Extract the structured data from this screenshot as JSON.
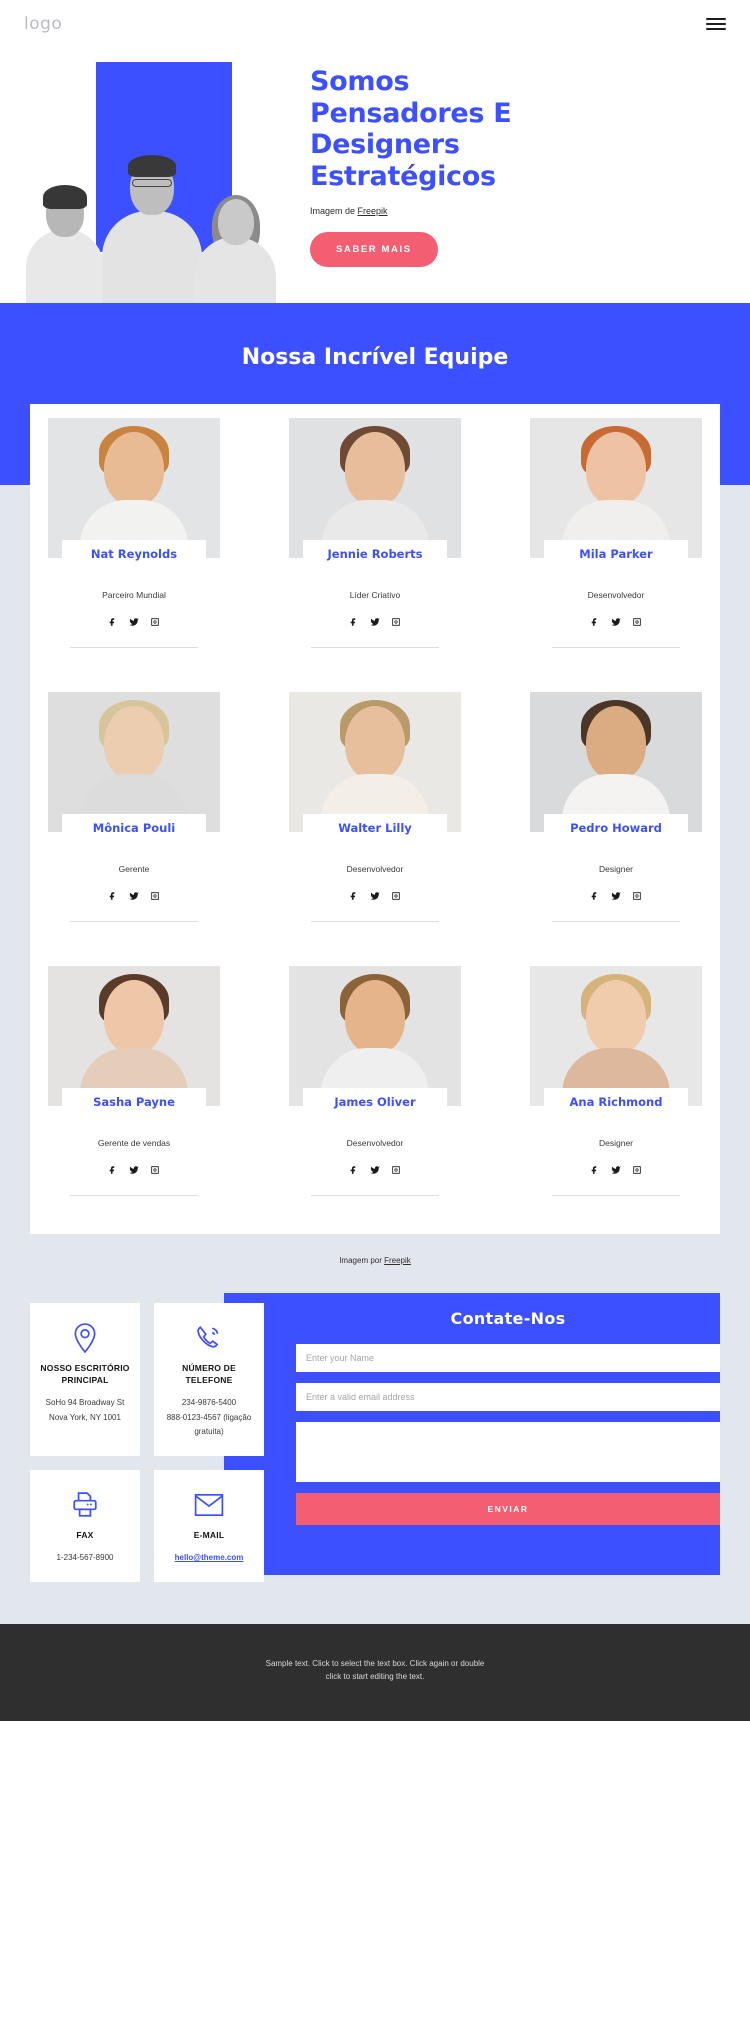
{
  "colors": {
    "brand_blue": "#3d50ff",
    "accent_pink": "#f45e72",
    "page_gray": "#e2e6ed",
    "footer_dark": "#2f2f2f"
  },
  "header": {
    "logo": "logo",
    "menu_icon": "hamburger-icon"
  },
  "hero": {
    "title_lines": [
      "Somos",
      "Pensadores E",
      "Designers",
      "Estratégicos"
    ],
    "credit_prefix": "Imagem de ",
    "credit_link": "Freepik",
    "cta_label": "SABER MAIS"
  },
  "team": {
    "title": "Nossa Incrível Equipe",
    "caption_prefix": "Imagem por ",
    "caption_link": "Freepik",
    "members": [
      {
        "name": "Nat Reynolds",
        "role": "Parceiro Mundial",
        "hair": "#c8833f",
        "skin": "#e8bb95",
        "shirt": "#f2f2f0",
        "bg": "#e3e4e6"
      },
      {
        "name": "Jennie Roberts",
        "role": "Líder Criativo",
        "hair": "#6e4a34",
        "skin": "#e7bd9c",
        "shirt": "#e9e9e9",
        "bg": "#dfe1e3"
      },
      {
        "name": "Mila Parker",
        "role": "Desenvolvedor",
        "hair": "#c96a34",
        "skin": "#eec3a4",
        "shirt": "#f0efed",
        "bg": "#e6e6e6"
      },
      {
        "name": "Mônica Pouli",
        "role": "Gerente",
        "hair": "#d8c49a",
        "skin": "#edcdb0",
        "shirt": "#dcdcdc",
        "bg": "#dddedd"
      },
      {
        "name": "Walter Lilly",
        "role": "Desenvolvedor",
        "hair": "#b99a6a",
        "skin": "#e8bf9d",
        "shirt": "#f3efe7",
        "bg": "#e9e8e4"
      },
      {
        "name": "Pedro Howard",
        "role": "Designer",
        "hair": "#4a3626",
        "skin": "#dbab82",
        "shirt": "#f4f3f1",
        "bg": "#d9dadc"
      },
      {
        "name": "Sasha Payne",
        "role": "Gerente de vendas",
        "hair": "#5a3a28",
        "skin": "#eec7a9",
        "shirt": "#e4cdb9",
        "bg": "#e4e3e1"
      },
      {
        "name": "James Oliver",
        "role": "Desenvolvedor",
        "hair": "#8c6239",
        "skin": "#e5b48b",
        "shirt": "#efefef",
        "bg": "#e3e3e3"
      },
      {
        "name": "Ana Richmond",
        "role": "Designer",
        "hair": "#d6b37a",
        "skin": "#f0cbac",
        "shirt": "#ddb89c",
        "bg": "#e6e7e6"
      }
    ],
    "social_icons": [
      "facebook-icon",
      "twitter-icon",
      "instagram-icon"
    ]
  },
  "contact": {
    "cards": [
      {
        "icon": "location-pin-icon",
        "title": "NOSSO ESCRITÓRIO PRINCIPAL",
        "lines": [
          "SoHo 94 Broadway St",
          "Nova York, NY 1001"
        ],
        "link": ""
      },
      {
        "icon": "phone-call-icon",
        "title": "NÚMERO DE TELEFONE",
        "lines": [
          "234-9876-5400",
          "888-0123-4567 (ligação gratuita)"
        ],
        "link": ""
      },
      {
        "icon": "printer-icon",
        "title": "FAX",
        "lines": [
          "1-234-567-8900"
        ],
        "link": ""
      },
      {
        "icon": "envelope-icon",
        "title": "E-MAIL",
        "lines": [],
        "link": "hello@theme.com"
      }
    ],
    "form": {
      "title": "Contate-Nos",
      "name_placeholder": "Enter your Name",
      "name_value": "",
      "email_placeholder": "Enter a valid email address",
      "email_value": "",
      "message_placeholder": "",
      "message_value": "",
      "submit_label": "ENVIAR"
    }
  },
  "footer": {
    "line1": "Sample text. Click to select the text box. Click again or double",
    "line2": "click to start editing the text."
  }
}
